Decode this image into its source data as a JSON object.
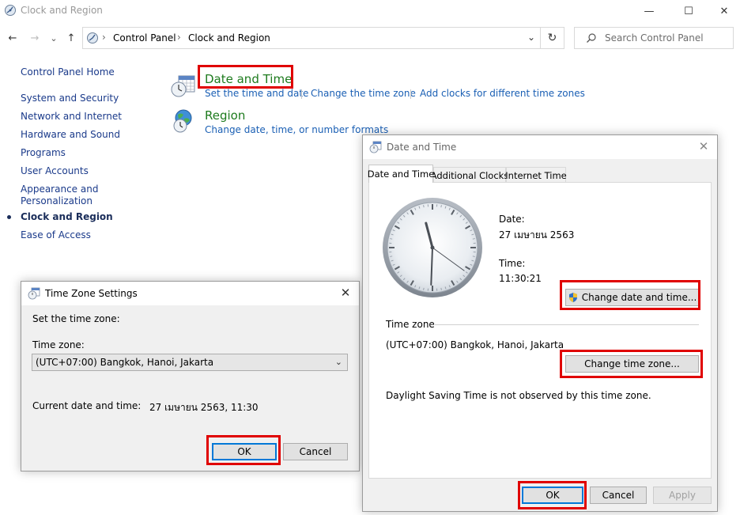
{
  "window": {
    "title": "Clock and Region",
    "minimize_glyph": "—",
    "maximize_glyph": "☐",
    "close_glyph": "✕"
  },
  "nav": {
    "back_glyph": "←",
    "forward_glyph": "→",
    "recent_glyph": "⌄",
    "up_glyph": "↑",
    "breadcrumbs": [
      "Control Panel",
      "Clock and Region"
    ],
    "breadcrumb_sep": "›",
    "dropdown_glyph": "⌄",
    "refresh_glyph": "↻",
    "search_placeholder": "Search Control Panel"
  },
  "sidebar": {
    "items": [
      {
        "label": "Control Panel Home"
      },
      {
        "label": "System and Security"
      },
      {
        "label": "Network and Internet"
      },
      {
        "label": "Hardware and Sound"
      },
      {
        "label": "Programs"
      },
      {
        "label": "User Accounts"
      },
      {
        "label": "Appearance and"
      },
      {
        "label": "Personalization"
      },
      {
        "label": "Clock and Region"
      },
      {
        "label": "Ease of Access"
      }
    ]
  },
  "categories": {
    "date_time": {
      "title": "Date and Time",
      "links": [
        "Set the time and date",
        "Change the time zone",
        "Add clocks for different time zones"
      ]
    },
    "region": {
      "title": "Region",
      "links": [
        "Change date, time, or number formats"
      ]
    }
  },
  "timezone_dialog": {
    "title": "Time Zone Settings",
    "close_glyph": "✕",
    "set_label": "Set the time zone:",
    "tz_label": "Time zone:",
    "tz_value": "(UTC+07:00) Bangkok, Hanoi, Jakarta",
    "arrow_glyph": "⌄",
    "current_label": "Current date and time:",
    "current_value": "27 เมษายน 2563, 11:30",
    "ok": "OK",
    "cancel": "Cancel"
  },
  "datetime_dialog": {
    "title": "Date and Time",
    "close_glyph": "✕",
    "tabs": [
      "Date and Time",
      "Additional Clocks",
      "Internet Time"
    ],
    "date_label": "Date:",
    "date_value": "27 เมษายน 2563",
    "time_label": "Time:",
    "time_value": "11:30:21",
    "change_datetime": "Change date and time...",
    "tz_section": "Time zone",
    "tz_value": "(UTC+07:00) Bangkok, Hanoi, Jakarta",
    "change_tz": "Change time zone...",
    "dst_note": "Daylight Saving Time is not observed by this time zone.",
    "ok": "OK",
    "cancel": "Cancel",
    "apply": "Apply",
    "clock": {
      "hours": 11,
      "minutes": 30,
      "seconds": 21
    }
  },
  "colors": {
    "highlight": "#e00000",
    "link": "#1a5fb4",
    "category_title": "#1e7b1e"
  }
}
